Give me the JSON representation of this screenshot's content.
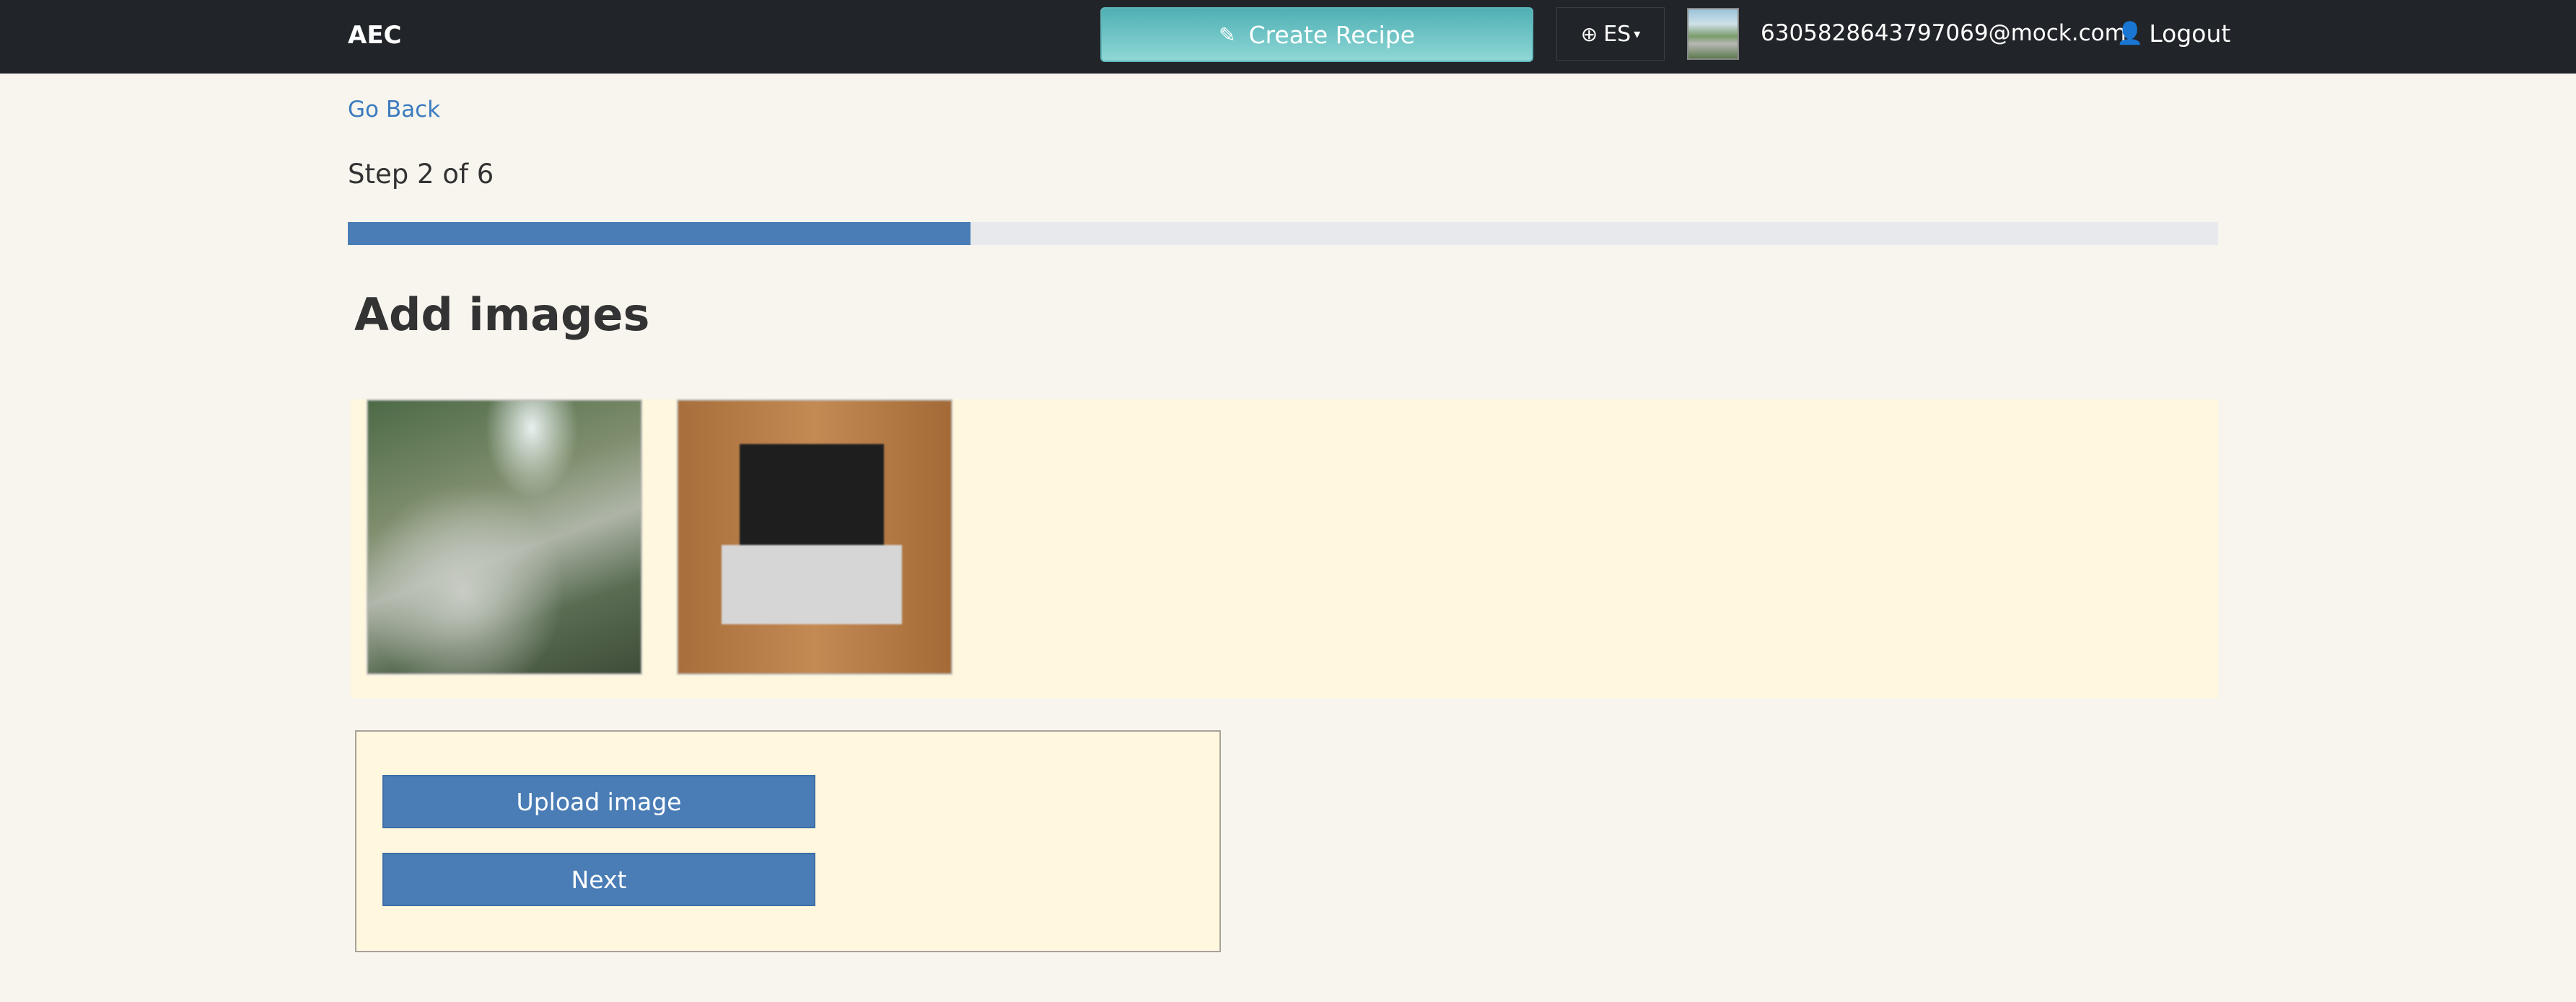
{
  "navbar": {
    "brand": "AEC",
    "create_recipe_label": "Create Recipe",
    "language": "ES",
    "user_email": "6305828643797069@mock.com",
    "logout_label": "Logout"
  },
  "page": {
    "go_back_label": "Go Back",
    "step_text": "Step 2 of 6",
    "progress_fraction": 0.333,
    "title": "Add images"
  },
  "gallery": {
    "images": [
      {
        "name": "waterfall-photo"
      },
      {
        "name": "laptop-photo"
      }
    ]
  },
  "actions": {
    "upload_label": "Upload image",
    "next_label": "Next"
  },
  "colors": {
    "navbar_bg": "#212529",
    "accent_blue": "#4a7db6",
    "teal_button": "#4fb0b4",
    "panel_bg": "#fff7de",
    "page_bg": "#f8f5ef"
  }
}
